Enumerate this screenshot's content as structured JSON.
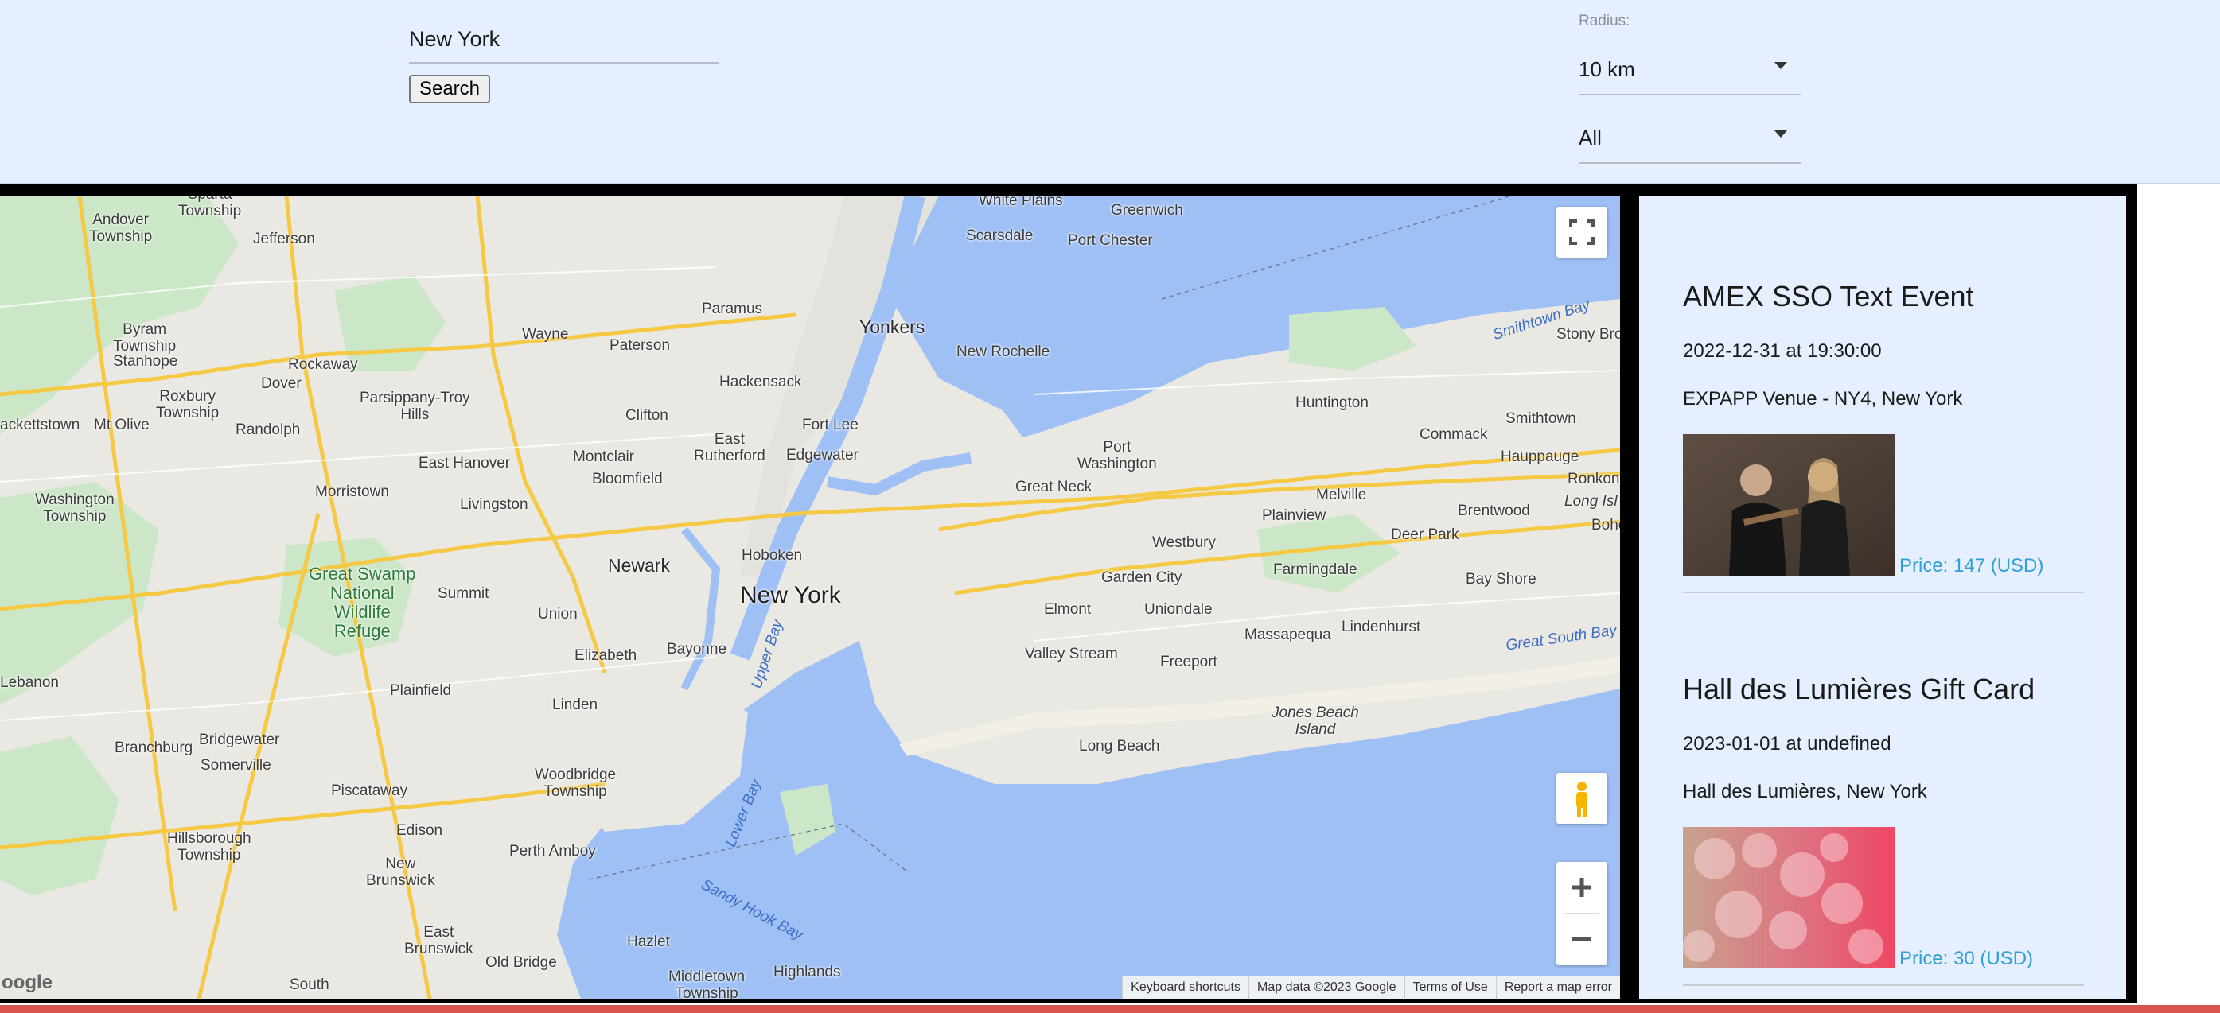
{
  "search": {
    "value": "New York",
    "button_label": "Search"
  },
  "filters": {
    "radius_label": "Radius:",
    "radius_value": "10 km",
    "category_value": "All"
  },
  "map": {
    "labels": {
      "new_york": "New York",
      "newark": "Newark",
      "yonkers": "Yonkers",
      "white_plains": "White Plains",
      "scarsdale": "Scarsdale",
      "greenwich": "Greenwich",
      "port_chester": "Port Chester",
      "new_rochelle": "New Rochelle",
      "paramus": "Paramus",
      "hackensack": "Hackensack",
      "paterson": "Paterson",
      "wayne": "Wayne",
      "fort_lee": "Fort Lee",
      "edgewater": "Edgewater",
      "clifton": "Clifton",
      "east_rutherford": "East\nRutherford",
      "montclair": "Montclair",
      "bloomfield": "Bloomfield",
      "hoboken": "Hoboken",
      "livingston": "Livingston",
      "east_hanover": "East Hanover",
      "morristown": "Morristown",
      "summit": "Summit",
      "union": "Union",
      "elizabeth": "Elizabeth",
      "bayonne": "Bayonne",
      "linden": "Linden",
      "plainfield": "Plainfield",
      "woodbridge": "Woodbridge\nTownship",
      "edison": "Edison",
      "perth_amboy": "Perth Amboy",
      "piscataway": "Piscataway",
      "new_brunswick": "New\nBrunswick",
      "east_brunswick": "East\nBrunswick",
      "hazlet": "Hazlet",
      "old_bridge": "Old Bridge",
      "middletown": "Middletown\nTownship",
      "highlands": "Highlands",
      "south": "South",
      "somerville": "Somerville",
      "bridgewater": "Bridgewater",
      "branchburg": "Branchburg",
      "hillsborough": "Hillsborough\nTownship",
      "lebanon": "Lebanon",
      "washington": "Washington\nTownship",
      "randolph": "Randolph",
      "dover": "Dover",
      "rockaway": "Rockaway",
      "jefferson": "Jefferson",
      "andover": "Andover\nTownship",
      "byram": "Byram\nTownship",
      "stanhope": "Stanhope",
      "roxbury": "Roxbury\nTownship",
      "mt_olive": "Mt Olive",
      "hackettstown": "ackettstown",
      "parsippany": "Parsippany-Troy\nHills",
      "sparta": "Sparta\nTownship",
      "great_swamp": "Great Swamp\nNational\nWildlife\nRefuge",
      "port_washington": "Port\nWashington",
      "great_neck": "Great Neck",
      "huntington": "Huntington",
      "commack": "Commack",
      "smithtown": "Smithtown",
      "hauppauge": "Hauppauge",
      "stony_brook": "Stony Bro",
      "ronkonk": "Ronkon",
      "long_isl": "Long Isl",
      "bohe": "Bohe",
      "melville": "Melville",
      "plainview": "Plainview",
      "deer_park": "Deer Park",
      "brentwood": "Brentwood",
      "westbury": "Westbury",
      "garden_city": "Garden City",
      "farmingdale": "Farmingdale",
      "bay_shore": "Bay Shore",
      "elmont": "Elmont",
      "uniondale": "Uniondale",
      "massapequa": "Massapequa",
      "lindenhurst": "Lindenhurst",
      "valley_stream": "Valley Stream",
      "freeport": "Freeport",
      "long_beach": "Long Beach",
      "jones_beach": "Jones Beach\nIsland",
      "smithtown_bay": "Smithtown Bay",
      "great_south_bay": "Great South Bay",
      "upper_bay": "Upper Bay",
      "lower_bay": "Lower Bay",
      "sandy_hook_bay": "Sandy Hook Bay"
    },
    "attribution": [
      "Keyboard shortcuts",
      "Map data ©2023 Google",
      "Terms of Use",
      "Report a map error"
    ],
    "logo_text": "oogle",
    "controls": [
      "fullscreen-icon",
      "pegman-icon",
      "zoom-in-icon",
      "zoom-out-icon"
    ]
  },
  "events": [
    {
      "title": "AMEX SSO Text Event",
      "date": "2022-12-31 at 19:30:00",
      "venue": "EXPAPP Venue - NY4, New York",
      "price": "Price: 147 (USD)"
    },
    {
      "title": "Hall des Lumières Gift Card",
      "date": "2023-01-01 at undefined",
      "venue": "Hall des Lumières, New York",
      "price": "Price: 30 (USD)"
    }
  ],
  "colors": {
    "topbar": "#e6efff",
    "accent_price": "#2fa0d8",
    "bottom_bar": "#d9534f"
  }
}
